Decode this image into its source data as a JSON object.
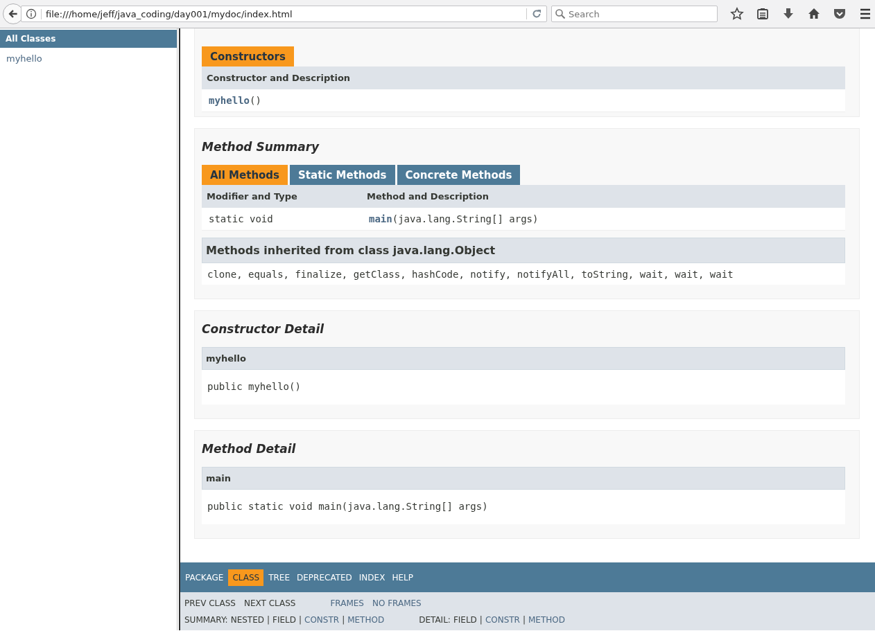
{
  "browser": {
    "url": "file:///home/jeff/java_coding/day001/mydoc/index.html",
    "search_placeholder": "Search"
  },
  "class_list": {
    "title": "All Classes",
    "classes": [
      "myhello"
    ]
  },
  "constructor_summary": {
    "tab": "Constructors",
    "column": "Constructor and Description",
    "rows": [
      {
        "name": "myhello",
        "args": "()"
      }
    ]
  },
  "method_summary": {
    "title": "Method Summary",
    "tabs": [
      {
        "label": "All Methods",
        "selected": true
      },
      {
        "label": "Static Methods",
        "selected": false
      },
      {
        "label": "Concrete Methods",
        "selected": false
      }
    ],
    "columns": [
      "Modifier and Type",
      "Method and Description"
    ],
    "rows": [
      {
        "modifier": "static void",
        "name": "main",
        "args": "(java.lang.String[] args)"
      }
    ],
    "inherited": {
      "title": "Methods inherited from class java.lang.Object",
      "methods": "clone, equals, finalize, getClass, hashCode, notify, notifyAll, toString, wait, wait, wait"
    }
  },
  "constructor_detail": {
    "title": "Constructor Detail",
    "items": [
      {
        "name": "myhello",
        "signature": "public myhello()"
      }
    ]
  },
  "method_detail": {
    "title": "Method Detail",
    "items": [
      {
        "name": "main",
        "signature": "public static void main(java.lang.String[] args)"
      }
    ]
  },
  "nav": {
    "items": [
      {
        "label": "PACKAGE",
        "selected": false
      },
      {
        "label": "CLASS",
        "selected": true
      },
      {
        "label": "TREE",
        "selected": false
      },
      {
        "label": "DEPRECATED",
        "selected": false
      },
      {
        "label": "INDEX",
        "selected": false
      },
      {
        "label": "HELP",
        "selected": false
      }
    ],
    "sub_rows": [
      [
        [
          {
            "text": "PREV CLASS",
            "kind": "text"
          },
          {
            "text": "NEXT CLASS",
            "kind": "text"
          }
        ],
        [
          {
            "text": "FRAMES",
            "kind": "link"
          },
          {
            "text": "NO FRAMES",
            "kind": "link"
          }
        ]
      ],
      [
        [
          {
            "text": "SUMMARY:",
            "kind": "text"
          },
          {
            "text": "NESTED",
            "kind": "text"
          },
          {
            "text": "|",
            "kind": "sep"
          },
          {
            "text": "FIELD",
            "kind": "text"
          },
          {
            "text": "|",
            "kind": "sep"
          },
          {
            "text": "CONSTR",
            "kind": "link"
          },
          {
            "text": "|",
            "kind": "sep"
          },
          {
            "text": "METHOD",
            "kind": "link"
          }
        ],
        [
          {
            "text": "DETAIL:",
            "kind": "text"
          },
          {
            "text": "FIELD",
            "kind": "text"
          },
          {
            "text": "|",
            "kind": "sep"
          },
          {
            "text": "CONSTR",
            "kind": "link"
          },
          {
            "text": "|",
            "kind": "sep"
          },
          {
            "text": "METHOD",
            "kind": "link"
          }
        ]
      ]
    ]
  }
}
